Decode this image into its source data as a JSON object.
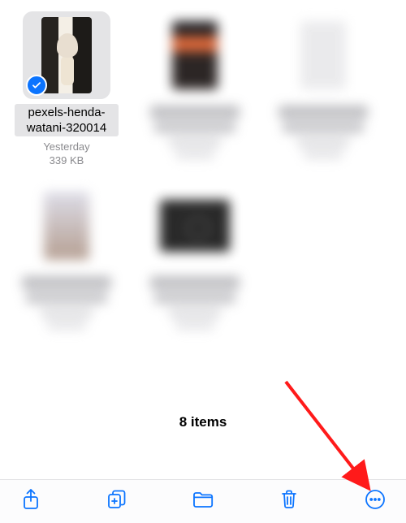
{
  "files": {
    "selected": {
      "name": "pexels-henda-watani-320014",
      "date": "Yesterday",
      "size": "339 KB"
    }
  },
  "footer": {
    "count_label": "8 items"
  },
  "toolbar": {
    "share": "Share",
    "duplicate": "Duplicate",
    "move": "Move",
    "delete": "Delete",
    "more": "More"
  }
}
